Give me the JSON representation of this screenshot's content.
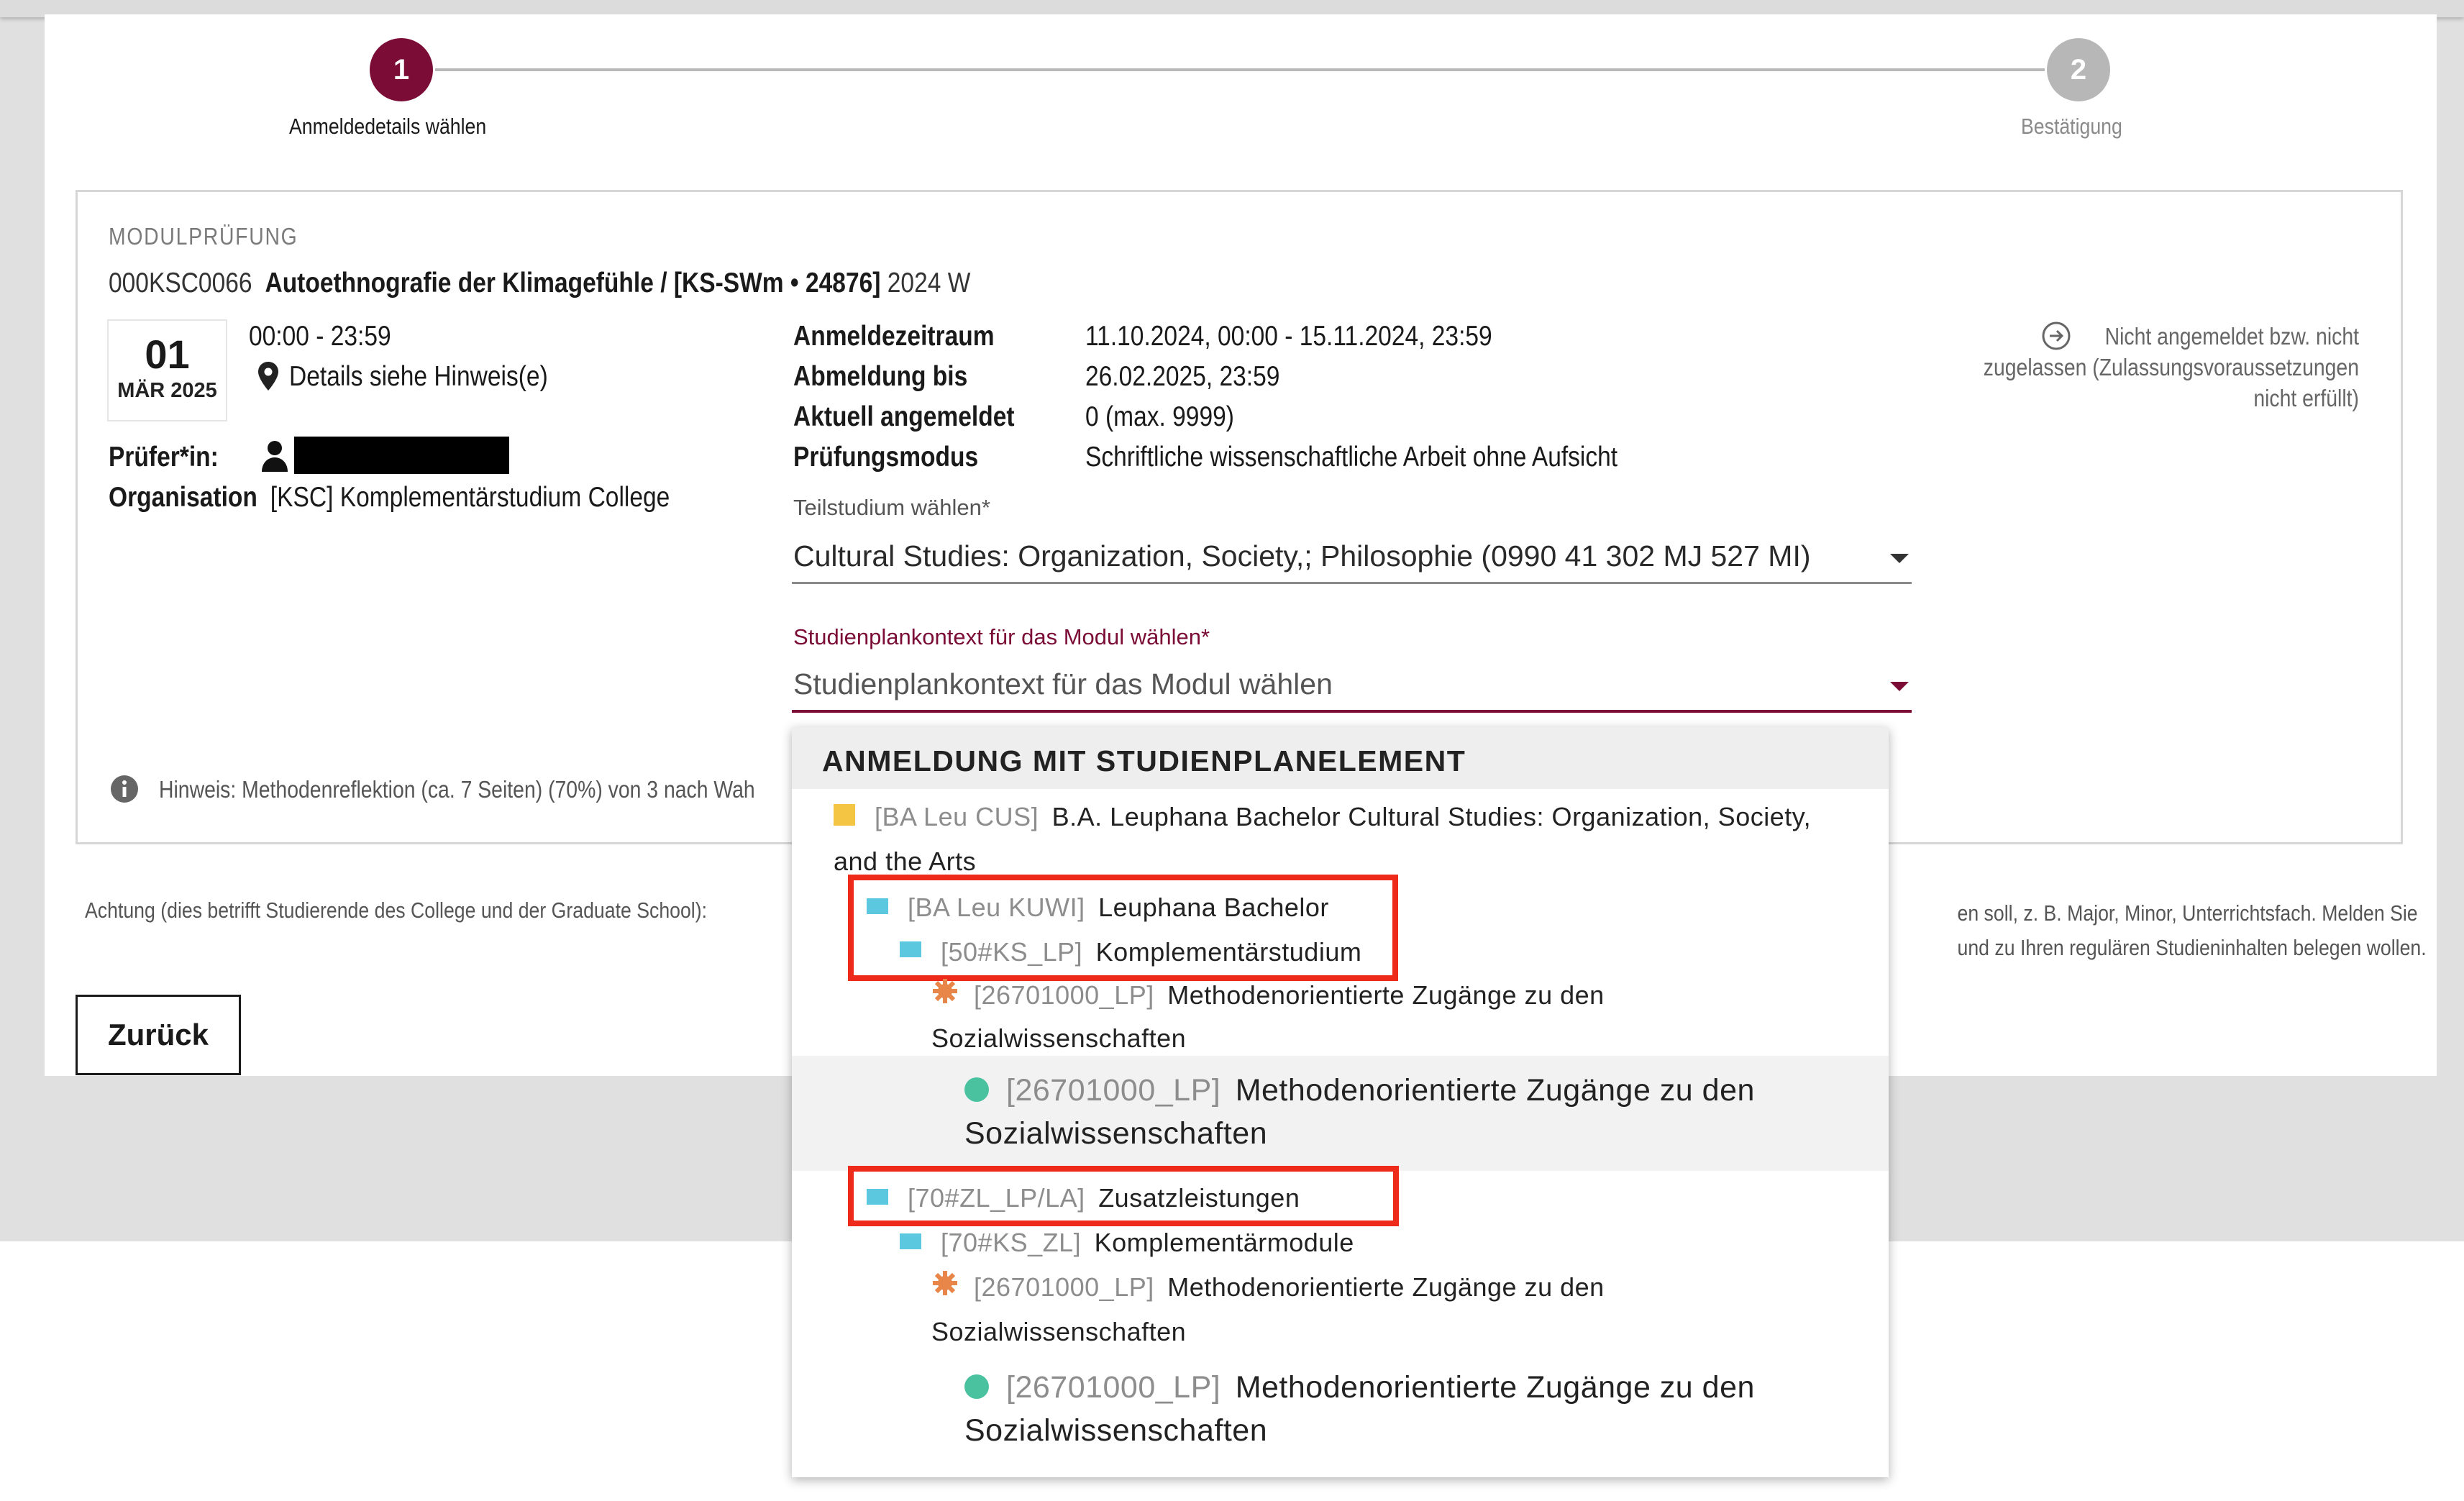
{
  "stepper": {
    "step1_number": "1",
    "step1_label": "Anmeldedetails wählen",
    "step2_number": "2",
    "step2_label": "Bestätigung"
  },
  "module": {
    "type_label": "MODULPRÜFUNG",
    "code": "000KSC0066",
    "title": "Autoethnografie der Klimagefühle / [KS-SWm • 24876]",
    "term": "2024 W",
    "date_day": "01",
    "date_month_year": "MÄR 2025",
    "time": "00:00 - 23:59",
    "location": "Details siehe Hinweis(e)",
    "examiner_label": "Prüfer*in:",
    "organisation_label": "Organisation",
    "organisation_value": "[KSC] Komplementärstudium College",
    "details": [
      {
        "label": "Anmeldezeitraum",
        "value": "11.10.2024, 00:00 - 15.11.2024, 23:59"
      },
      {
        "label": "Abmeldung bis",
        "value": "26.02.2025, 23:59"
      },
      {
        "label": "Aktuell angemeldet",
        "value": "0 (max. 9999)"
      },
      {
        "label": "Prüfungsmodus",
        "value": "Schriftliche wissenschaftliche Arbeit ohne Aufsicht"
      }
    ],
    "status_line1": "Nicht angemeldet bzw. nicht",
    "status_line2": "zugelassen (Zulassungsvoraussetzungen",
    "status_line3": "nicht erfüllt)",
    "hint": "Hinweis: Methodenreflektion (ca. 7 Seiten) (70%)  von 3 nach Wah"
  },
  "form": {
    "teilstudium_label": "Teilstudium wählen*",
    "teilstudium_value": "Cultural Studies: Organization, Society,; Philosophie (0990 41 302 MJ 527 MI)",
    "kontext_label": "Studienplankontext für das Modul wählen*",
    "kontext_placeholder": "Studienplankontext für das Modul wählen"
  },
  "notice": {
    "left": "Achtung (dies betrifft Studierende des College und der Graduate School):",
    "right1": "en soll, z. B. Major, Minor, Unterrichtsfach. Melden Sie",
    "right2": "und zu Ihren regulären Studieninhalten belegen wollen."
  },
  "back_button": "Zurück",
  "dropdown": {
    "header": "ANMELDUNG MIT STUDIENPLANELEMENT",
    "items": [
      {
        "code": "[BA Leu CUS]",
        "name": "B.A. Leuphana Bachelor Cultural Studies: Organization, Society,",
        "cont": "and the Arts",
        "icon": "yellow-square-icon"
      },
      {
        "code": "[BA Leu KUWI]",
        "name": "Leuphana Bachelor",
        "icon": "blue-square-icon"
      },
      {
        "code": "[50#KS_LP]",
        "name": "Komplementärstudium",
        "icon": "blue-square-icon"
      },
      {
        "code": "[26701000_LP]",
        "name": "Methodenorientierte Zugänge zu den",
        "cont": "Sozialwissenschaften",
        "icon": "orange-gear-icon"
      },
      {
        "code": "[26701000_LP]",
        "name": "Methodenorientierte Zugänge zu den",
        "cont": "Sozialwissenschaften",
        "icon": "green-dot-icon"
      },
      {
        "code": "[70#ZL_LP/LA]",
        "name": "Zusatzleistungen",
        "icon": "blue-square-icon"
      },
      {
        "code": "[70#KS_ZL]",
        "name": "Komplementärmodule",
        "icon": "blue-square-icon"
      },
      {
        "code": "[26701000_LP]",
        "name": "Methodenorientierte Zugänge zu den",
        "cont": "Sozialwissenschaften",
        "icon": "orange-gear-icon"
      },
      {
        "code": "[26701000_LP]",
        "name": "Methodenorientierte Zugänge zu den",
        "cont": "Sozialwissenschaften",
        "icon": "green-dot-icon"
      }
    ]
  },
  "colors": {
    "brand": "#7a0c35",
    "highlight_red": "#ee2a1a",
    "tree_blue": "#5bc8df",
    "tree_yellow": "#f4c542",
    "tree_orange": "#e8864a",
    "tree_green": "#4ac2a0"
  }
}
